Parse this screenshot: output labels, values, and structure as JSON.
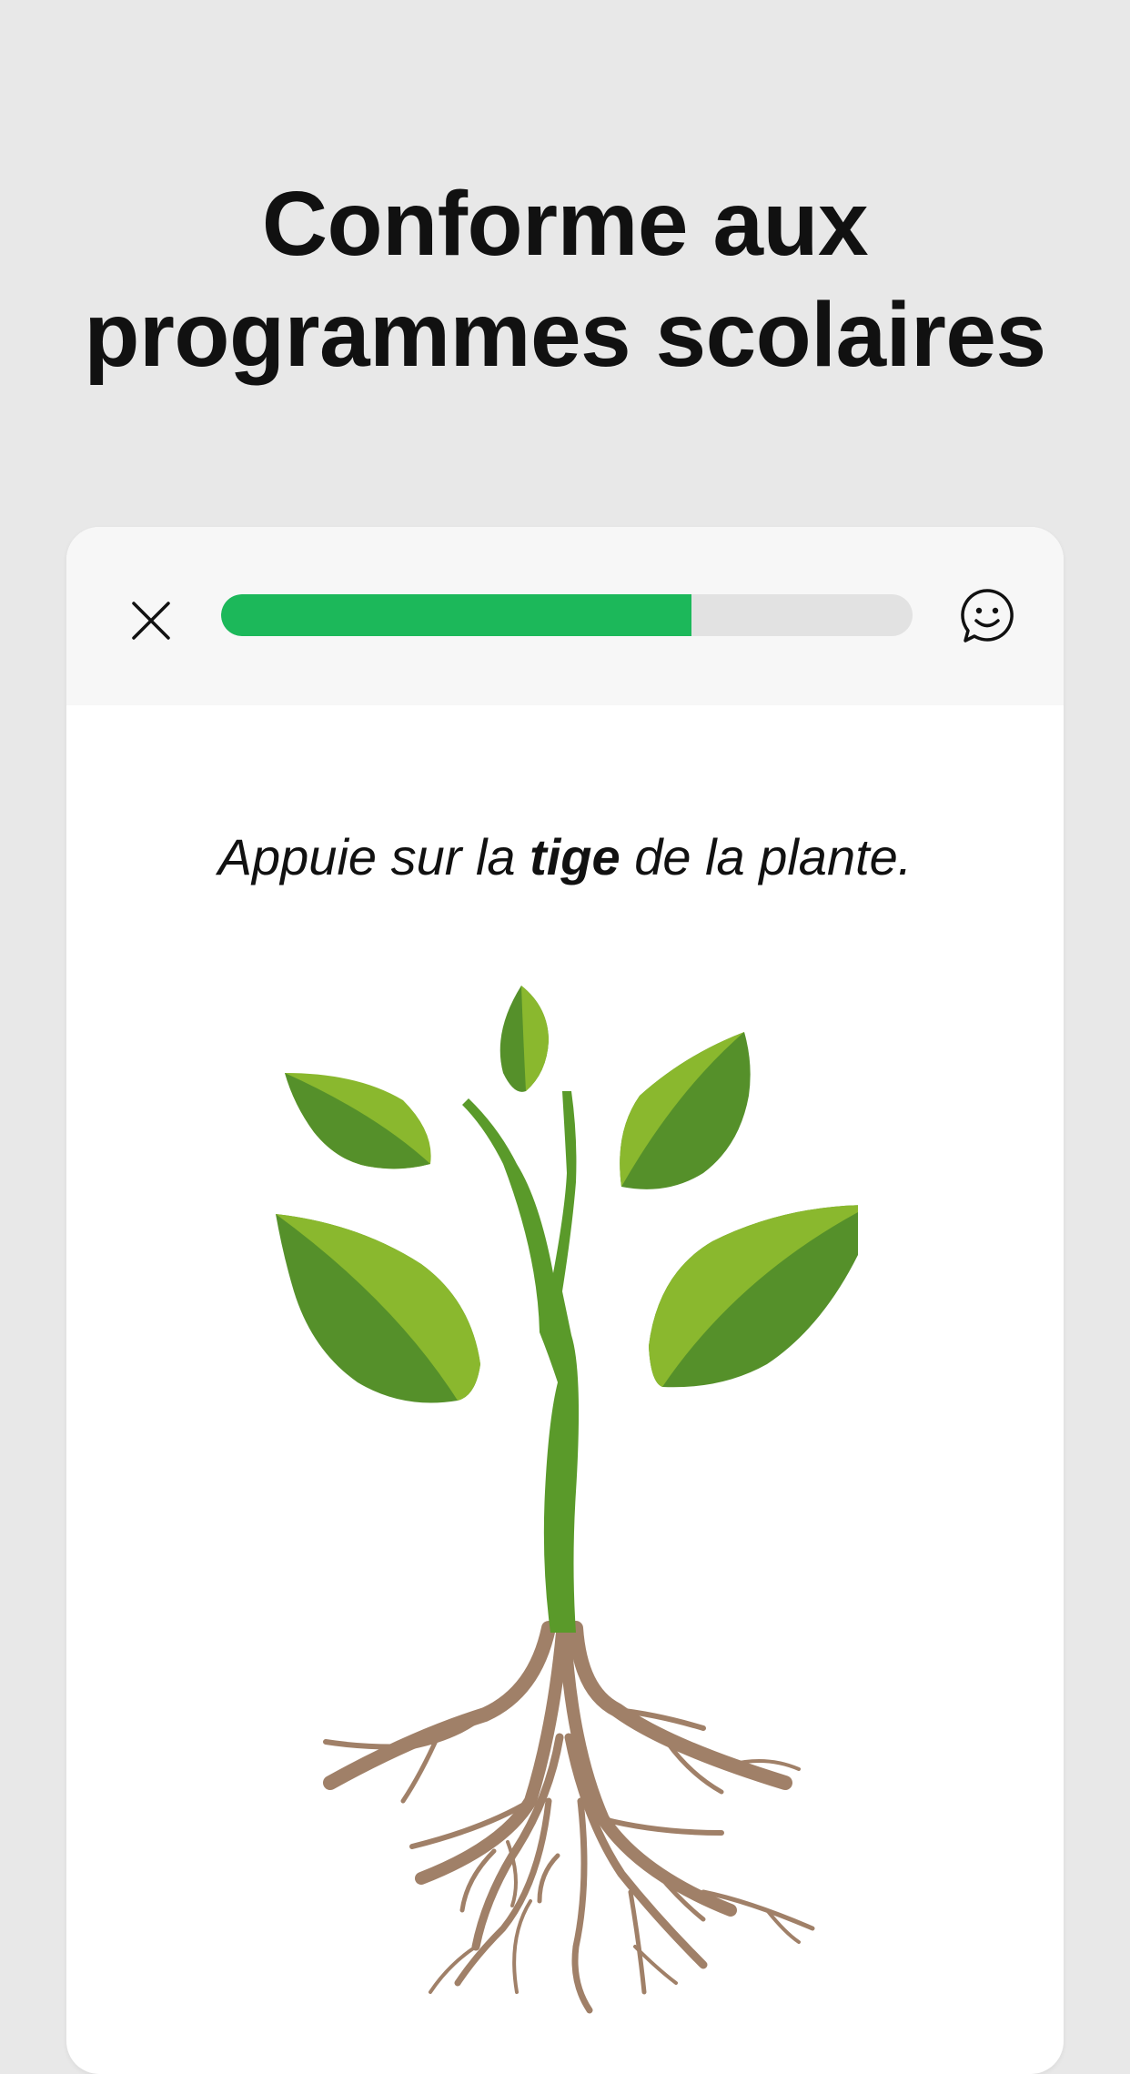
{
  "headline": {
    "line1": "Conforme aux",
    "line2": "programmes scolaires"
  },
  "header": {
    "close_icon": "close-icon",
    "feedback_icon": "smiley-speech-bubble-icon",
    "progress": 0.68,
    "progress_color": "#1cb85a",
    "track_color": "#e2e2e2"
  },
  "question": {
    "before": "Appuie sur la ",
    "keyword": "tige",
    "after": " de la plante."
  },
  "illustration": {
    "subject": "plant",
    "parts": [
      "leaves",
      "stem",
      "roots"
    ],
    "leaf_dark": "#55902a",
    "leaf_light": "#8ab82e",
    "stem_color": "#5a9a2a",
    "root_color": "#a08068"
  }
}
